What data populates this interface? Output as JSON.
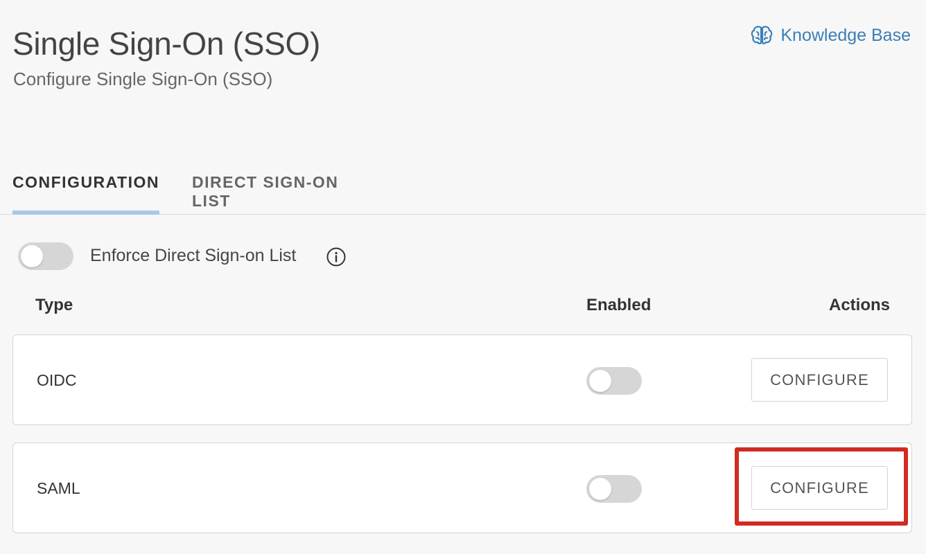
{
  "header": {
    "title": "Single Sign-On (SSO)",
    "subtitle": "Configure Single Sign-On (SSO)",
    "knowledge_base": {
      "label": "Knowledge Base",
      "icon": "brain-icon"
    }
  },
  "tabs": [
    {
      "label": "CONFIGURATION",
      "active": true
    },
    {
      "label": "DIRECT SIGN-ON LIST",
      "active": false
    }
  ],
  "enforce": {
    "label": "Enforce Direct Sign-on List",
    "enabled": false,
    "info_icon": "info-icon"
  },
  "table": {
    "columns": [
      "Type",
      "Enabled",
      "Actions"
    ],
    "rows": [
      {
        "type": "OIDC",
        "enabled": false,
        "action": "CONFIGURE"
      },
      {
        "type": "SAML",
        "enabled": false,
        "action": "CONFIGURE"
      }
    ]
  },
  "colors": {
    "link": "#3a7fb8",
    "tab_underline": "#a9c8e6",
    "highlight": "#d12b21"
  }
}
